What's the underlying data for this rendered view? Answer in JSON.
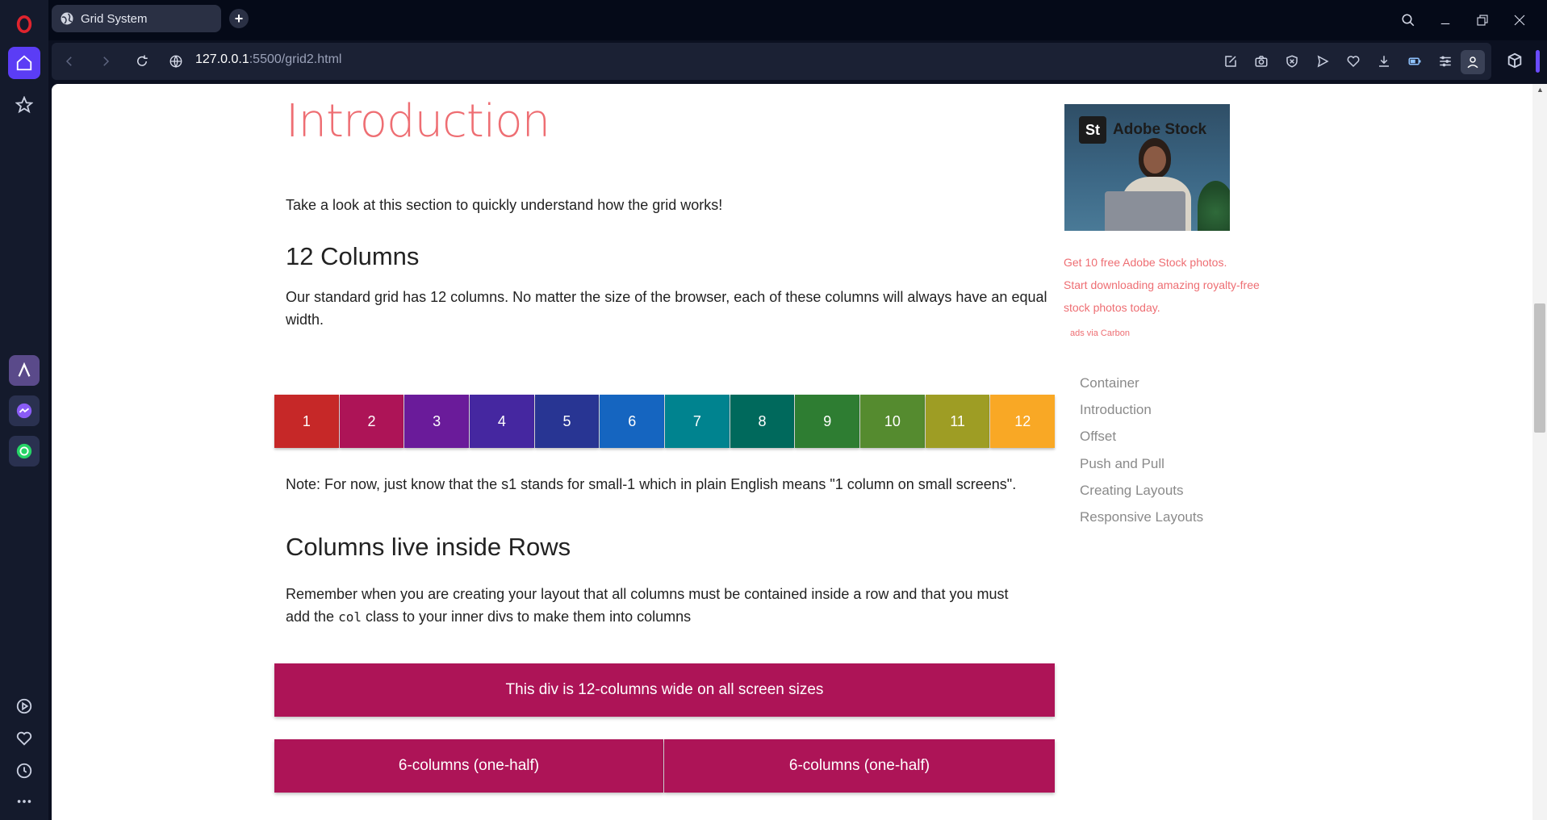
{
  "browser": {
    "tab_title": "Grid System",
    "url_host": "127.0.0.1",
    "url_rest": ":5500/grid2.html"
  },
  "page": {
    "intro_title": "Introduction",
    "intro_text": "Take a look at this section to quickly understand how the grid works!",
    "twelve_title": "12 Columns",
    "twelve_text": "Our standard grid has 12 columns. No matter the size of the browser, each of these columns will always have an equal width.",
    "columns": [
      {
        "label": "1",
        "color": "#c62828"
      },
      {
        "label": "2",
        "color": "#ad1457"
      },
      {
        "label": "3",
        "color": "#6a1b9a"
      },
      {
        "label": "4",
        "color": "#4527a0"
      },
      {
        "label": "5",
        "color": "#283593"
      },
      {
        "label": "6",
        "color": "#1565c0"
      },
      {
        "label": "7",
        "color": "#00838f"
      },
      {
        "label": "8",
        "color": "#00695c"
      },
      {
        "label": "9",
        "color": "#2e7d32"
      },
      {
        "label": "10",
        "color": "#558b2f"
      },
      {
        "label": "11",
        "color": "#9e9d24"
      },
      {
        "label": "12",
        "color": "#f9a825"
      }
    ],
    "note_text": "Note: For now, just know that the s1 stands for small-1 which in plain English means \"1 column on small screens\".",
    "rows_title": "Columns live inside Rows",
    "rows_text_a": "Remember when you are creating your layout that all columns must be contained inside a row and that you must",
    "rows_text_b": "add the ",
    "rows_code": "col",
    "rows_text_c": " class to your inner divs to make them into columns",
    "full_box": "This div is 12-columns wide on all screen sizes",
    "half_box_left": "6-columns (one-half)",
    "half_box_right": "6-columns (one-half)"
  },
  "ad": {
    "brand": "Adobe Stock",
    "logo_letters": "St",
    "line1": "Get 10 free Adobe Stock photos.",
    "line2": "Start downloading amazing royalty-free",
    "line3": "stock photos today.",
    "via": "ads via Carbon"
  },
  "toc": [
    "Container",
    "Introduction",
    "Offset",
    "Push and Pull",
    "Creating Layouts",
    "Responsive Layouts"
  ],
  "colors": {
    "accent": "#ee6e73",
    "pink_box": "#ad1457",
    "browser_accent": "#5b3df5"
  }
}
